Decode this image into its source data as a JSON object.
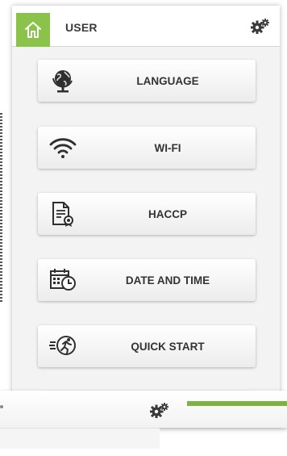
{
  "header": {
    "title": "USER"
  },
  "menu": [
    {
      "label": "LANGUAGE",
      "icon": "globe-icon"
    },
    {
      "label": "WI-FI",
      "icon": "wifi-icon"
    },
    {
      "label": "HACCP",
      "icon": "haccp-document-icon"
    },
    {
      "label": "DATE AND TIME",
      "icon": "calendar-clock-icon"
    },
    {
      "label": "QUICK START",
      "icon": "running-man-icon"
    }
  ],
  "colors": {
    "accent": "#8bc34a",
    "text": "#333333",
    "panel": "#f3f3f3"
  }
}
